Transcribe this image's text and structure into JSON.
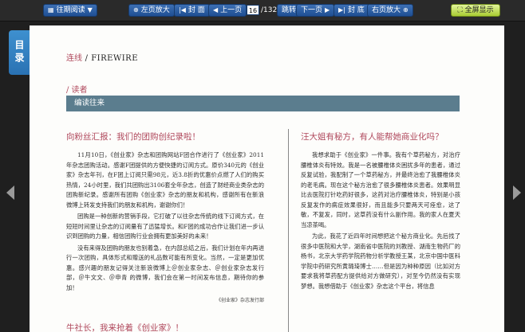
{
  "toolbar": {
    "past_issues": "往期阅读",
    "left_zoom": "左页放大",
    "cover": "封 面",
    "prev": "上一页",
    "page_current": "16",
    "page_total": "/132",
    "goto": "跳转",
    "next": "下一页",
    "back_cover": "封 底",
    "right_zoom": "右页放大",
    "fullscreen": "全屏显示"
  },
  "sidebar": {
    "toc_label": "目录"
  },
  "page": {
    "section": "连线",
    "section_sep": " / ",
    "section_en": "FIREWIRE",
    "reader_label": "/ 读者",
    "band_label": "编读往来",
    "left_article": {
      "title": "向粉丝汇报：我们的团购创纪录啦！",
      "paragraphs": [
        "11月10日，《创业家》杂志和团购网站F团合作进行了《创业家》2011年杂志团购活动。感谢F团提供的方便快捷的订阅方式。原价340元的《创业家》杂志年刊，在F团上订阅只需98元，近3.8折的优惠价点燃了人们的购买热情，24小时里，我们共团购出3106套全年杂志，创造了财经商业类杂志的团购新纪录。感谢所有团购《创业家》杂志的朋友和机构，感谢所有在新浪微博上转发支持我们的朋友和机构，谢谢你们！",
        "团购是一种创新的营销手段，它打破了以往杂志传统的线下订阅方式，在短短时间里让杂志的订阅量有了迅猛增长。和F团的成功合作让我们进一步认识到团购的力量，相信团购行业会拥有更加美好的未来！",
        "没有来得及团购的朋友也别着急，在内部总结之后，我们计划在年内再进行一次团购，具体形式和赠送的礼品数可能有所变化。当然，一定是更加优惠。感兴趣的朋友记得关注新浪微博上＠创业家杂志、＠创业家杂志发行部，＠牛文文、＠申青 的微博，我们会在第一时间发布信息，期待你的参加！"
      ],
      "source": "《创业家》杂志发行部"
    },
    "right_article": {
      "title": "汪大姐有秘方，有人能帮她商业化吗？",
      "paragraphs": [
        "我想求助于《创业家》一件事。我有个草药秘方，对治疗腰椎体炎有特效。我是一名被腰椎体炎困扰多年的患者，通过反复试验，我配制了一个草药秘方，并最终治愈了我腰椎体炎的老毛病。现在这个秘方治愈了很多腰椎体炎患者。效果明显比去医院打针吃药好很多，这药对治疗腰椎体炎，特别是小孩反复发作的病症效果很好，而且能多只要两天可痊愈，这了敏，不复发，同时，这草药没有什么副作用。我的家人在夏天当凉茶喝。",
        "为此，我花了近四年时间想把这个秘方商业化。先后找了很多中医院和大学，湖南省中医院的刘教授、湖南生物药厂的杨书，北京大学药学院药物分析学教授王某，北京中国中医科学院中药研究所黄璐琦博士……但是因为种种原因（比如对方要求我将草药配方提供给对方做研究），对至今仍然没有实现梦想。我想借助于《创业家》杂志这个平台，将信息"
      ]
    },
    "next_title": "牛社长，我来抢着《创业家》！"
  }
}
